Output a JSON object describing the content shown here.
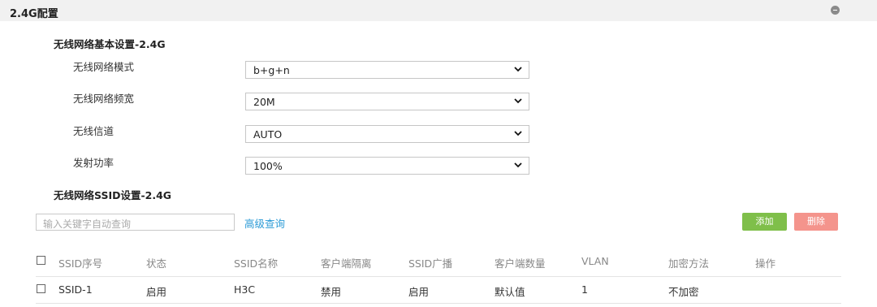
{
  "panel": {
    "title": "2.4G配置",
    "collapse_icon": "minus-circle-icon"
  },
  "basic": {
    "title": "无线网络基本设置-2.4G",
    "rows": [
      {
        "label": "无线网络模式",
        "value": "b+g+n"
      },
      {
        "label": "无线网络频宽",
        "value": "20M"
      },
      {
        "label": "无线信道",
        "value": "AUTO"
      },
      {
        "label": "发射功率",
        "value": "100%"
      }
    ]
  },
  "ssid": {
    "title": "无线网络SSID设置-2.4G",
    "search_placeholder": "输入关键字自动查询",
    "advanced_query": "高级查询",
    "add_label": "添加",
    "delete_label": "删除",
    "add_color": "#7fbf4a",
    "delete_color": "#f4948c",
    "columns": [
      "SSID序号",
      "状态",
      "SSID名称",
      "客户端隔离",
      "SSID广播",
      "客户端数量",
      "VLAN",
      "加密方法",
      "操作"
    ],
    "rows": [
      [
        "SSID-1",
        "启用",
        "H3C",
        "禁用",
        "启用",
        "默认值",
        "1",
        "不加密",
        ""
      ]
    ]
  }
}
